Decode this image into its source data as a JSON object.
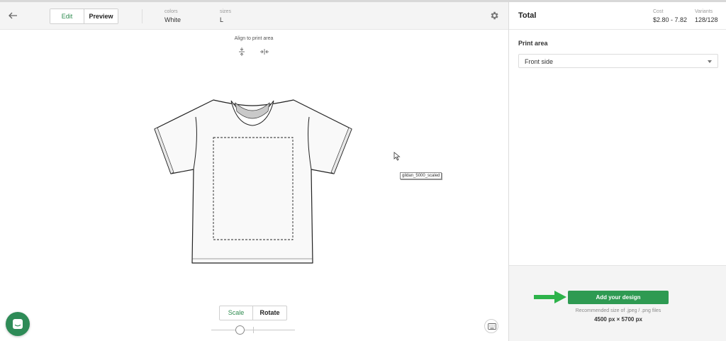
{
  "header": {
    "tabs": [
      {
        "label": "Edit",
        "active": true
      },
      {
        "label": "Preview",
        "active": false
      }
    ],
    "colors_label": "colors",
    "colors_value": "White",
    "sizes_label": "sizes",
    "sizes_value": "L"
  },
  "canvas": {
    "align_title": "Align to print area",
    "file_label": "gildan_5000_scaled",
    "transform_tabs": [
      {
        "label": "Scale",
        "active": true
      },
      {
        "label": "Rotate",
        "active": false
      }
    ],
    "scale_level": 0.35
  },
  "panel": {
    "title": "Total",
    "cost_label": "Cost",
    "cost_value": "$2.80 - 7.82",
    "variants_label": "Variants",
    "variants_value": "128/128",
    "print_area_label": "Print area",
    "print_area_value": "Front side",
    "add_button": "Add your design",
    "recommend_text": "Recommended size of .jpeg / .png files",
    "recommend_size": "4500 px × 5700 px"
  },
  "colors": {
    "accent": "#2e8b4f",
    "button_green": "#2e9a52",
    "arrow_green": "#2db34a",
    "chat_green": "#2e8b57"
  },
  "icons": [
    "back-arrow-icon",
    "gear-icon",
    "align-vertical-center-icon",
    "align-horizontal-center-icon",
    "mouse-cursor-icon",
    "keyboard-icon",
    "chat-icon",
    "arrow-right-icon",
    "caret-down-icon"
  ]
}
